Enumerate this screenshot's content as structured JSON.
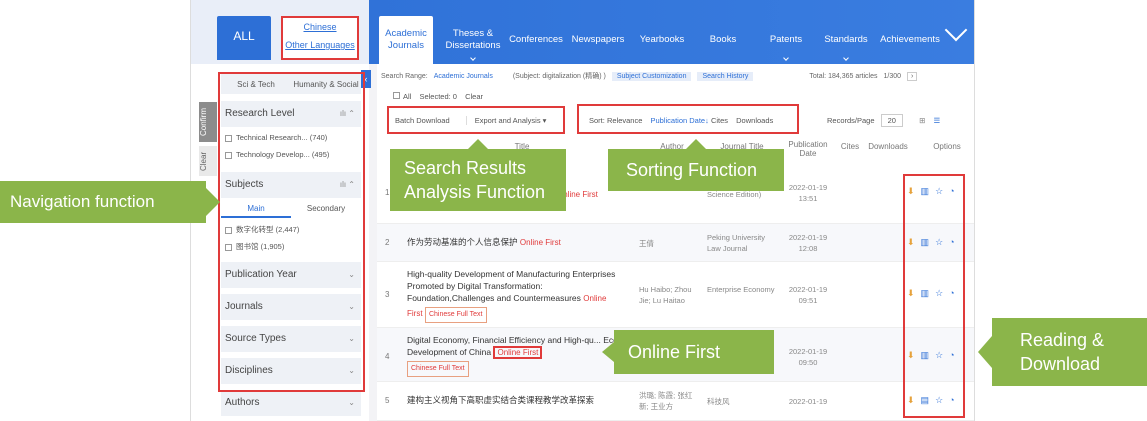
{
  "lang": {
    "all": "ALL",
    "chinese": "Chinese",
    "other": "Other Languages"
  },
  "nav_tabs": [
    "Academic Journals",
    "Theses & Dissertations",
    "Conferences",
    "Newspapers",
    "Yearbooks",
    "Books",
    "Patents",
    "Standards",
    "Achievements"
  ],
  "sidebar": {
    "tab_sci": "Sci & Tech",
    "tab_hum": "Humanity & Social",
    "confirm": "Confirm",
    "clear": "Clear",
    "research_level": "Research Level",
    "rl_items": [
      "Technical Research... (740)",
      "Technology Develop... (495)"
    ],
    "subjects": "Subjects",
    "sub_main": "Main",
    "sub_secondary": "Secondary",
    "subj_items": [
      "数字化转型 (2,447)",
      "图书馆 (1,905)"
    ],
    "sections": [
      "Publication Year",
      "Journals",
      "Source Types",
      "Disciplines",
      "Authors"
    ]
  },
  "main": {
    "search_range_label": "Search Range:",
    "search_range_value": "Academic Journals",
    "subject": "(Subject: digitalization (精确) )",
    "subject_customization": "Subject Customization",
    "search_history": "Search History",
    "total": "Total: 184,365  articles",
    "page": "1/300",
    "all": "All",
    "selected": "Selected: 0",
    "clear": "Clear",
    "batch_download": "Batch Download",
    "export_analysis": "Export and Analysis ▾",
    "sort_label": "Sort:",
    "sort_relevance": "Relevance",
    "sort_pubdate": "Publication Date↓",
    "sort_cites": "Cites",
    "sort_downloads": "Downloads",
    "records_per_page": "Records/Page",
    "records_value": "20",
    "col_title": "Title",
    "col_author": "Author",
    "col_journal": "Journal Title",
    "col_pubdate": "Publication Date",
    "col_cites": "Cites",
    "col_downloads": "Downloads",
    "col_options": "Options"
  },
  "rows": [
    {
      "num": "1",
      "title": "",
      "tag": "Online First",
      "author": "",
      "source": "University(Social Science Edition)",
      "date": "2022-01-19",
      "time": "13:51"
    },
    {
      "num": "2",
      "title": "作为劳动基准的个人信息保护",
      "tag": "Online First",
      "author": "王倩",
      "source": "Peking University Law Journal",
      "date": "2022-01-19",
      "time": "12:08"
    },
    {
      "num": "3",
      "title": "High-quality Development of Manufacturing Enterprises Promoted by Digital Transformation: Foundation,Challenges and Countermeasures",
      "tag": "Online First",
      "fulltext": "Chinese Full Text",
      "author": "Hu Haibo; Zhou Jie; Lu Haitao",
      "source": "Enterprise Economy",
      "date": "2022-01-19",
      "time": "09:51"
    },
    {
      "num": "4",
      "title": "Digital Economy, Financial Efficiency and High-qu... Economic Development of China",
      "tag": "Online First",
      "fulltext": "Chinese Full Text",
      "author": "",
      "source": "",
      "date": "2022-01-19",
      "time": "09:50"
    },
    {
      "num": "5",
      "title": "建构主义视角下高职虚实结合类课程教学改革探索",
      "tag": "",
      "author": "洪璐; 陈霞; 张红新; 王业方",
      "source": "科技风",
      "date": "2022-01-19",
      "time": ""
    }
  ],
  "callouts": {
    "navigation": "Navigation function",
    "analysis": "Search Results Analysis Function",
    "sorting": "Sorting Function",
    "online_first": "Online First",
    "reading": "Reading & Download"
  },
  "colors": {
    "accent": "#2d6fd6",
    "callout": "#8bb54a",
    "highlight": "#e03a3a"
  }
}
